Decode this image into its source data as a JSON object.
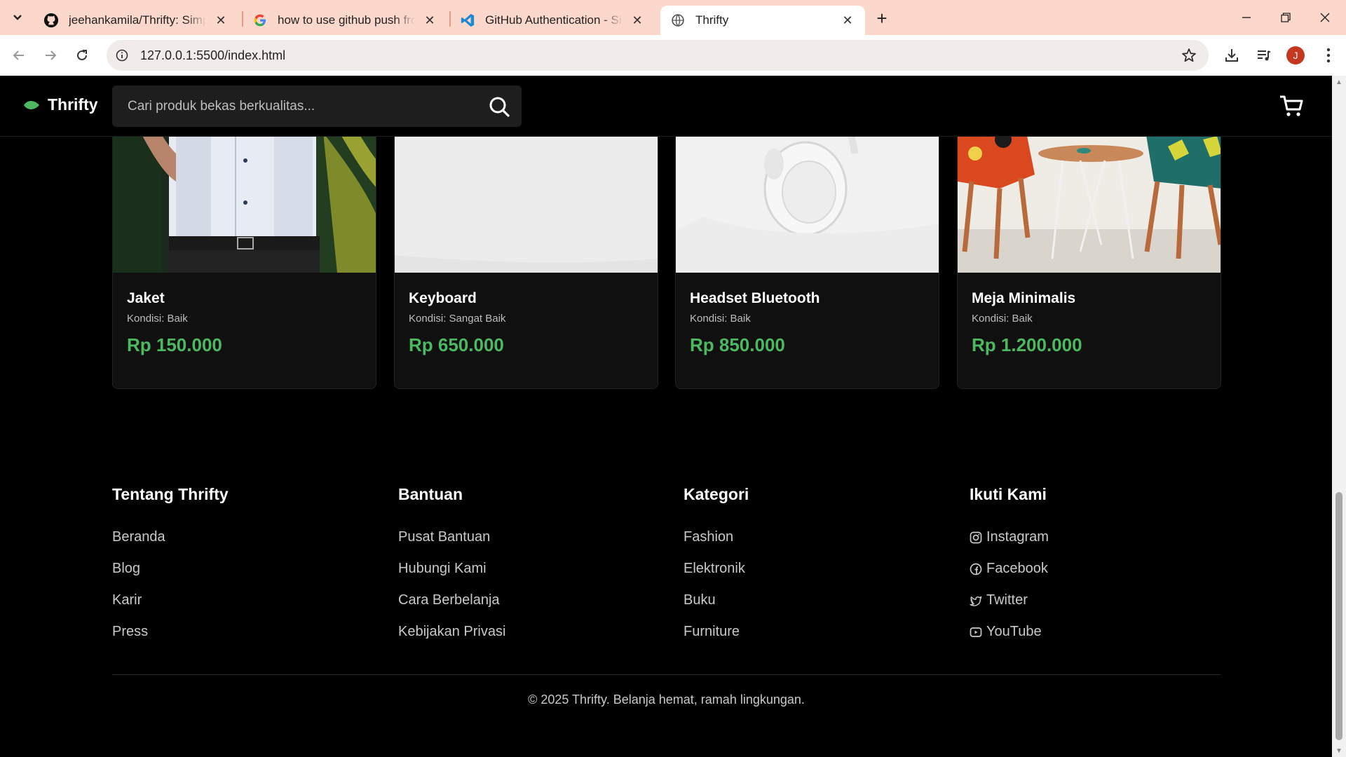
{
  "browser": {
    "tabs": [
      {
        "title": "jeehankamila/Thrifty: Simple web",
        "icon": "github-icon"
      },
      {
        "title": "how to use github push from an",
        "icon": "google-icon"
      },
      {
        "title": "GitHub Authentication - Sign In",
        "icon": "vscode-icon"
      },
      {
        "title": "Thrifty",
        "icon": "globe-icon",
        "active": true
      }
    ],
    "url": "127.0.0.1:5500/index.html",
    "avatar_letter": "J"
  },
  "site": {
    "brand": "Thrifty",
    "search_placeholder": "Cari produk bekas berkualitas...",
    "accent_color": "#4cb961"
  },
  "products": [
    {
      "name": "Jaket",
      "condition": "Kondisi: Baik",
      "price": "Rp 150.000",
      "image": "man-in-shirt-photo"
    },
    {
      "name": "Keyboard",
      "condition": "Kondisi: Sangat Baik",
      "price": "Rp 650.000",
      "image": "white-keyboard-photo"
    },
    {
      "name": "Headset Bluetooth",
      "condition": "Kondisi: Baik",
      "price": "Rp 850.000",
      "image": "white-headphones-photo"
    },
    {
      "name": "Meja Minimalis",
      "condition": "Kondisi: Baik",
      "price": "Rp 1.200.000",
      "image": "table-and-chairs-photo"
    }
  ],
  "footer": {
    "columns": [
      {
        "title": "Tentang Thrifty",
        "links": [
          "Beranda",
          "Blog",
          "Karir",
          "Press"
        ]
      },
      {
        "title": "Bantuan",
        "links": [
          "Pusat Bantuan",
          "Hubungi Kami",
          "Cara Berbelanja",
          "Kebijakan Privasi"
        ]
      },
      {
        "title": "Kategori",
        "links": [
          "Fashion",
          "Elektronik",
          "Buku",
          "Furniture"
        ]
      },
      {
        "title": "Ikuti Kami",
        "links": [
          "Instagram",
          "Facebook",
          "Twitter",
          "YouTube"
        ],
        "icons": [
          "instagram-icon",
          "facebook-icon",
          "twitter-icon",
          "youtube-icon"
        ]
      }
    ],
    "copyright": "© 2025 Thrifty. Belanja hemat, ramah lingkungan."
  }
}
